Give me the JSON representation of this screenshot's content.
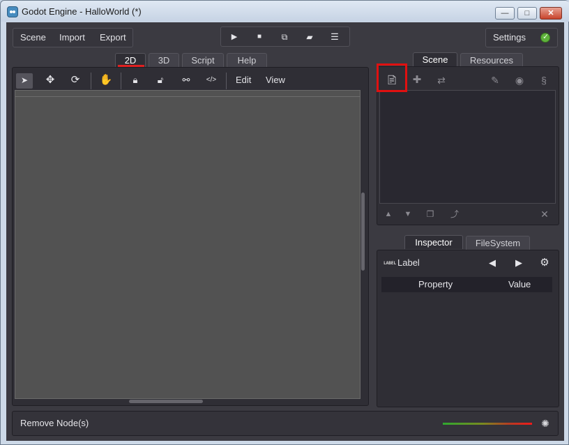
{
  "window": {
    "title": "Godot Engine - HalloWorld (*)",
    "controls": {
      "minimize": "—",
      "maximize": "□",
      "close": "✕"
    }
  },
  "menu": {
    "scene": "Scene",
    "import": "Import",
    "export": "Export"
  },
  "playback": {
    "play_icon": "play-icon",
    "stop_icon": "stop-icon",
    "play_scene_icon": "play-scene-icon",
    "open_icon": "folder-open-icon",
    "more_icon": "list-icon"
  },
  "settings": {
    "label": "Settings",
    "status_color": "#5fb23c"
  },
  "editor_tabs": [
    {
      "label": "2D",
      "active": true
    },
    {
      "label": "3D",
      "active": false
    },
    {
      "label": "Script",
      "active": false
    },
    {
      "label": "Help",
      "active": false
    }
  ],
  "toolbar_2d": {
    "edit": "Edit",
    "view": "View",
    "tools": [
      "select-icon",
      "move-icon",
      "rotate-icon",
      "pan-icon",
      "lock-icon",
      "unlock-icon",
      "group-icon",
      "ungroup-icon"
    ]
  },
  "scene_dock": {
    "tabs": [
      {
        "label": "Scene",
        "active": true
      },
      {
        "label": "Resources",
        "active": false
      }
    ],
    "toolbar": [
      "new-scene-icon",
      "add-node-icon",
      "instance-icon",
      "plugin-icon",
      "visibility-icon",
      "script-icon"
    ],
    "bottom_toolbar": [
      "move-up-icon",
      "move-down-icon",
      "duplicate-icon",
      "reparent-icon",
      "delete-icon"
    ]
  },
  "inspector_dock": {
    "tabs": [
      {
        "label": "Inspector",
        "active": true
      },
      {
        "label": "FileSystem",
        "active": false
      }
    ],
    "node_badge": "LABEL",
    "node_name": "Label",
    "columns": [
      "Property",
      "Value"
    ]
  },
  "status": {
    "message": "Remove Node(s)",
    "accent": "#e02020"
  }
}
